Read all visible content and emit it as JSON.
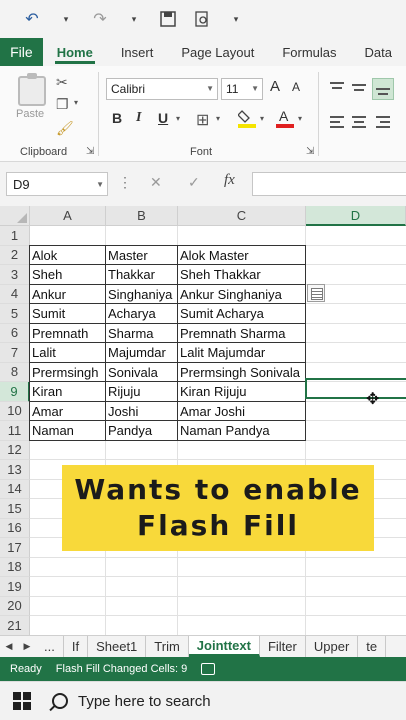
{
  "ribbon_tabs": [
    "File",
    "Home",
    "Insert",
    "Page Layout",
    "Formulas",
    "Data"
  ],
  "active_tab": "Home",
  "ribbon": {
    "paste_label": "Paste",
    "clipboard_label": "Clipboard",
    "font_label": "Font",
    "font_name": "Calibri",
    "font_size": "11",
    "grow_font": "A",
    "shrink_font": "A",
    "bold": "B",
    "italic": "I",
    "underline": "U",
    "font_color_glyph": "A"
  },
  "formula_bar": {
    "name_box": "D9",
    "fx": "fx",
    "formula": ""
  },
  "columns": [
    "A",
    "B",
    "C",
    "D"
  ],
  "rows": [
    "1",
    "2",
    "3",
    "4",
    "5",
    "6",
    "7",
    "8",
    "9",
    "10",
    "11",
    "12",
    "13",
    "14",
    "15",
    "16",
    "17",
    "18",
    "19",
    "20",
    "21"
  ],
  "selected": {
    "column": "D",
    "row": "9"
  },
  "table": [
    [
      "Alok",
      "Master",
      "Alok Master"
    ],
    [
      "Sheh",
      "Thakkar",
      "Sheh Thakkar"
    ],
    [
      "Ankur",
      "Singhaniya",
      "Ankur Singhaniya"
    ],
    [
      "Sumit",
      "Acharya",
      "Sumit Acharya"
    ],
    [
      "Premnath",
      "Sharma",
      "Premnath Sharma"
    ],
    [
      "Lalit",
      "Majumdar",
      "Lalit Majumdar"
    ],
    [
      "Prermsingh",
      "Sonivala",
      "Prermsingh Sonivala"
    ],
    [
      "Kiran",
      "Rijuju",
      "Kiran Rijuju"
    ],
    [
      "Amar",
      "Joshi",
      "Amar Joshi"
    ],
    [
      "Naman",
      "Pandya",
      "Naman Pandya"
    ]
  ],
  "banner": {
    "line1": "Wants to enable",
    "line2": "Flash Fill"
  },
  "sheet_tabs": [
    "...",
    "If",
    "Sheet1",
    "Trim",
    "Jointtext",
    "Filter",
    "Upper",
    "te"
  ],
  "active_sheet": "Jointtext",
  "status": {
    "ready": "Ready",
    "message": "Flash Fill Changed Cells: 9"
  },
  "taskbar": {
    "search_placeholder": "Type here to search"
  },
  "colors": {
    "excel_green": "#217346",
    "banner_yellow": "#f8d93a"
  }
}
